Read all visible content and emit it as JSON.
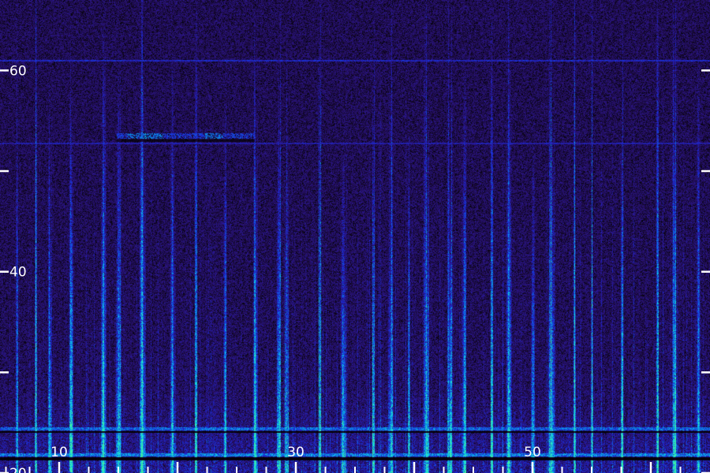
{
  "chart_data": {
    "type": "heatmap",
    "title": "",
    "xlabel": "",
    "ylabel": "",
    "xlim": [
      5,
      65
    ],
    "ylim": [
      20,
      67
    ],
    "x_ticks": [
      {
        "value": 10,
        "label": "10"
      },
      {
        "value": 20,
        "label": ""
      },
      {
        "value": 30,
        "label": "30"
      },
      {
        "value": 40,
        "label": ""
      },
      {
        "value": 50,
        "label": "50"
      },
      {
        "value": 60,
        "label": ""
      }
    ],
    "x_minor_ticks": [
      5.5,
      7.5,
      12.5,
      15,
      17.5,
      22.5,
      25,
      27.5,
      32.5,
      35,
      37.5,
      42.5,
      45,
      47.5,
      52.5,
      55,
      57.5,
      62.5
    ],
    "y_ticks": [
      {
        "value": 20,
        "label": "20"
      },
      {
        "value": 30,
        "label": ""
      },
      {
        "value": 40,
        "label": "40"
      },
      {
        "value": 50,
        "label": ""
      },
      {
        "value": 60,
        "label": "60"
      }
    ],
    "grid": false,
    "legend": "none",
    "colormap": [
      "#000000",
      "#1a0a3a",
      "#2a1480",
      "#1a2ad8",
      "#0a80e0",
      "#10d8e8",
      "#40f0a0"
    ],
    "dark_bands": [
      {
        "from": 21.3,
        "to": 21.6
      },
      {
        "from": 24.0,
        "to": 24.2
      }
    ],
    "bright_bands": [
      {
        "from": 21.7,
        "to": 22.0,
        "intensity": 0.75
      },
      {
        "from": 24.3,
        "to": 24.6,
        "intensity": 0.7
      }
    ],
    "faint_horizontal_lines": [
      {
        "y": 61.0,
        "intensity": 0.5
      },
      {
        "y": 52.8,
        "intensity": 0.45
      }
    ],
    "feature_trace": {
      "y": 53.5,
      "x_from": 14.8,
      "x_to": 26.5,
      "peak_x": [
        16.5,
        18.0,
        23.0
      ]
    },
    "strong_columns": [
      6.4,
      8.0,
      9.2,
      11.0,
      13.7,
      15.0,
      17.0,
      19.5,
      21.5,
      24.0,
      26.5,
      28.5,
      29.2,
      32.0,
      34.0,
      36.5,
      38.0,
      39.5,
      41.0,
      43.0,
      44.2,
      46.5,
      48.0,
      50.0,
      51.5,
      53.5,
      55.0,
      57.5,
      60.5,
      62.0,
      64.0
    ]
  }
}
